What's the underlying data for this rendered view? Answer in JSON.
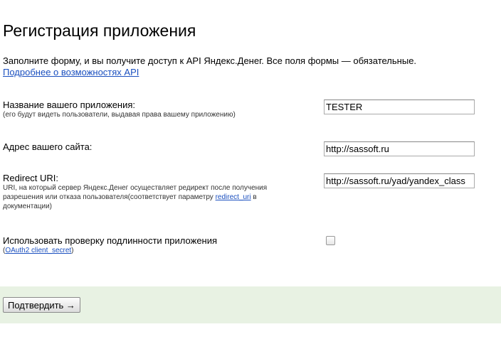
{
  "page": {
    "title": "Регистрация приложения",
    "intro_text": "Заполните форму, и вы получите доступ к API Яндекс.Денег. Все поля формы — обязательные.",
    "intro_link": "Подробнее о возможностях API"
  },
  "form": {
    "app_name": {
      "label": "Название вашего приложения:",
      "hint": "(его будут видеть пользователи, выдавая права вашему приложению)",
      "value": "TESTER"
    },
    "site_url": {
      "label": "Адрес вашего сайта:",
      "value": "http://sassoft.ru"
    },
    "redirect_uri": {
      "label": "Redirect URI:",
      "hint_prefix": "URI, на который сервер Яндекс.Денег осуществляет редирект после получения разрешения или отказа пользователя(соответствует параметру ",
      "hint_link": "redirect_uri",
      "hint_suffix": " в документации)",
      "value": "http://sassoft.ru/yad/yandex_class"
    },
    "auth_check": {
      "label": "Использовать проверку подлинности приложения",
      "hint_open": "(",
      "hint_link": "OAuth2 client_secret",
      "hint_close": ")",
      "checked": false
    }
  },
  "footer": {
    "submit_label": "Подтвердить →"
  }
}
